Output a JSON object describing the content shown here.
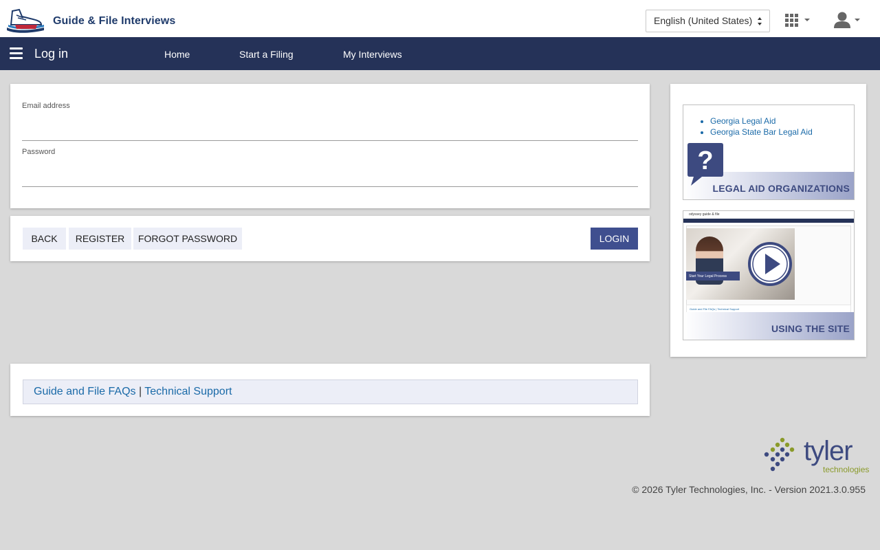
{
  "header": {
    "app_name": "Guide & File Interviews",
    "language_selected": "English (United States)",
    "icons": [
      "apps-grid-icon",
      "user-account-icon"
    ]
  },
  "navbar": {
    "page_title": "Log in",
    "links": [
      "Home",
      "Start a Filing",
      "My Interviews"
    ]
  },
  "login_form": {
    "email_label": "Email address",
    "email_value": "",
    "password_label": "Password",
    "password_value": ""
  },
  "actions": {
    "back": "BACK",
    "register": "REGISTER",
    "forgot_password": "FORGOT PASSWORD",
    "login": "LOGIN"
  },
  "help_links": {
    "faqs": "Guide and File FAQs",
    "separator": "|",
    "support": "Technical Support"
  },
  "sidebar": {
    "legal_aid_links": [
      "Georgia Legal Aid",
      "Georgia State Bar Legal Aid"
    ],
    "legal_aid_banner": "LEGAL AID ORGANIZATIONS",
    "video_thumb_title": "odyssey guide & file",
    "video_thumb_cta": "Start Your Legal Process",
    "video_thumb_footer": "Guide and File FAQs | Technical Support",
    "using_site_banner": "USING THE SITE"
  },
  "footer": {
    "brand": "tyler",
    "brand_sub": "technologies",
    "copyright": "© 2026 Tyler Technologies, Inc. - Version 2021.3.0.955"
  },
  "colors": {
    "nav_bg": "#253258",
    "accent": "#3f4f8f",
    "link": "#1a6aa8",
    "brand_green": "#8a9a2a"
  }
}
